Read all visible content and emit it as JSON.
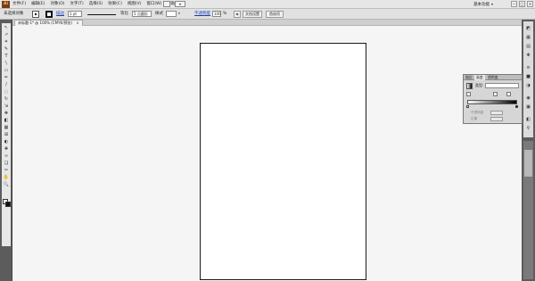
{
  "menubar": {
    "logo": "Ai",
    "items": [
      "文件(F)",
      "编辑(E)",
      "对象(O)",
      "文字(T)",
      "选择(S)",
      "效果(C)",
      "视图(V)",
      "窗口(W)",
      "帮助(H)"
    ],
    "workspace": "基本功能",
    "window_buttons": [
      "—",
      "□",
      "✕"
    ]
  },
  "controlbar": {
    "selection_status": "未选择对象",
    "stroke_label": "描边",
    "stroke_value": "1 pt",
    "brush_label": "等比",
    "points_value": "5 点圆形",
    "style_label": "样式",
    "opacity_label": "不透明度",
    "opacity_value": "100",
    "opacity_unit": "%",
    "doc_setup_button": "文档设置",
    "preferences_button": "首选项"
  },
  "document_tab": {
    "title": "未标题-1* @ 100% (CMYK/预览)",
    "close": "×"
  },
  "tools": [
    "↖",
    "↗",
    "✶",
    "✎",
    "T",
    "\\",
    "▭",
    "✏",
    "/",
    "◌",
    "↻",
    "⇲",
    "✥",
    "◧",
    "▦",
    "⊞",
    "◐",
    "✚",
    "∞",
    "❏",
    "✂",
    "✋",
    "🔍"
  ],
  "gradient_panel": {
    "tabs": [
      "描边",
      "渐变",
      "透明度"
    ],
    "active_tab": 1,
    "type_label": "类型:",
    "opacity_label": "不透明度",
    "position_label": "位置"
  },
  "colors": {
    "canvas_bg": "#f5f5f5",
    "artboard_border": "#1a1a1a",
    "panel_dark": "#5c5c5c",
    "link_blue": "#1a3fb0"
  }
}
